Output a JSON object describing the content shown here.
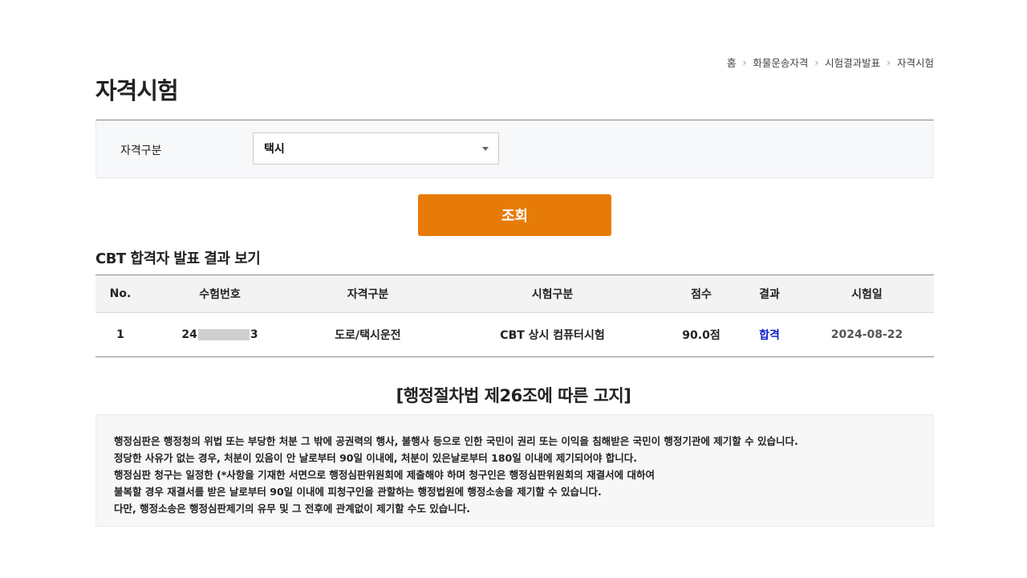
{
  "breadcrumb": [
    "홈",
    "화물운송자격",
    "시험결과발표",
    "자격시험"
  ],
  "page_title": "자격시험",
  "search": {
    "label": "자격구분",
    "selected": "택시"
  },
  "search_button": "조회",
  "section_title": "CBT 합격자 발표 결과 보기",
  "table": {
    "headers": [
      "No.",
      "수험번호",
      "자격구분",
      "시험구분",
      "점수",
      "결과",
      "시험일"
    ],
    "rows": [
      {
        "no": "1",
        "exam_no_prefix": "24",
        "exam_no_suffix": "3",
        "category": "도로/택시운전",
        "exam_type": "CBT 상시 컴퓨터시험",
        "score": "90.0점",
        "result": "합격",
        "date": "2024-08-22"
      }
    ]
  },
  "notice": {
    "title": "[행정절차법 제26조에 따른 고지]",
    "lines": [
      "행정심판은 행정청의 위법 또는 부당한 처분 그 밖에 공권력의 행사, 불행사 등으로 인한 국민이 권리 또는 이익을 침해받은 국민이 행정기관에 제기할 수 있습니다.",
      "정당한 사유가 없는 경우, 처분이 있음이 안 날로부터 90일 이내에, 처분이 있은날로부터 180일 이내에 제기되어야 합니다.",
      "행정심판 청구는 일정한 (*사항을 기재한 서면으로 행정심판위원회에 제출해야 하며 청구인은 행정심판위원회의 재결서에 대하여",
      "불복할 경우 재결서를 받은 날로부터 90일 이내에 피청구인을 관할하는 행정법원에 행정소송을 제기할 수 있습니다.",
      "다만, 행정소송은 행정심판제기의 유무 및 그 전후에 관계없이 제기할 수도 있습니다."
    ]
  },
  "colors": {
    "accent": "#e77b08",
    "pass": "#1020c8"
  }
}
